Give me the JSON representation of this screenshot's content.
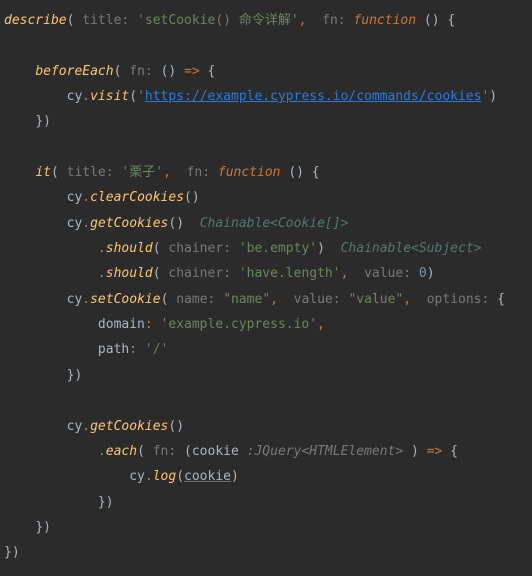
{
  "code": {
    "l1": {
      "fn": "describe",
      "hint1": "title:",
      "str1": "'setCookie() 命令详解'",
      "hint2": "fn:",
      "kw": "function"
    },
    "l3": {
      "fn": "beforeEach",
      "hint": "fn:"
    },
    "l4": {
      "obj": "cy",
      "method": "visit",
      "url": "https://example.cypress.io/commands/cookies"
    },
    "l7": {
      "fn": "it",
      "hint1": "title:",
      "str1": "'栗子'",
      "hint2": "fn:",
      "kw": "function"
    },
    "l8": {
      "obj": "cy",
      "method": "clearCookies"
    },
    "l9": {
      "obj": "cy",
      "method": "getCookies",
      "typehint": "Chainable<Cookie[]>"
    },
    "l10": {
      "method": "should",
      "hint": "chainer:",
      "str": "'be.empty'",
      "typehint": "Chainable<Subject>"
    },
    "l11": {
      "method": "should",
      "hint1": "chainer:",
      "str1": "'have.length'",
      "hint2": "value:",
      "num": "0"
    },
    "l12": {
      "obj": "cy",
      "method": "setCookie",
      "hint1": "name:",
      "str1": "\"name\"",
      "hint2": "value:",
      "str2": "\"value\"",
      "hint3": "options:"
    },
    "l13": {
      "key": "domain",
      "val": "'example.cypress.io'"
    },
    "l14": {
      "key": "path",
      "val": "'/'"
    },
    "l17": {
      "obj": "cy",
      "method": "getCookies"
    },
    "l18": {
      "method": "each",
      "hint": "fn:",
      "param": "cookie",
      "typehint": ":JQuery<HTMLElement>"
    },
    "l19": {
      "obj": "cy",
      "method": "log",
      "arg": "cookie"
    }
  }
}
